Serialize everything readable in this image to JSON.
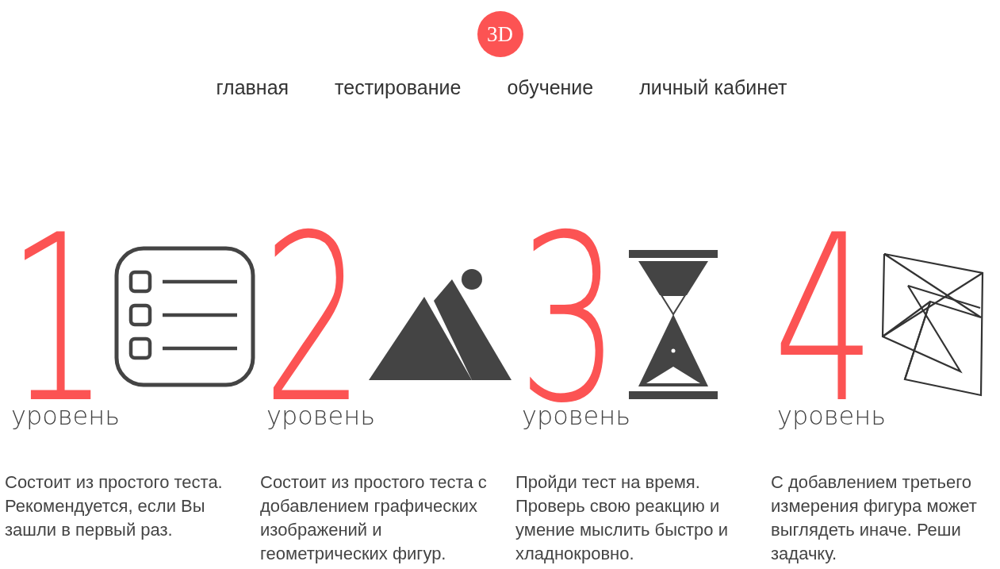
{
  "logo": {
    "text": "3D"
  },
  "nav": [
    "главная",
    "тестирование",
    "обучение",
    "личный кабинет"
  ],
  "levels": [
    {
      "number": "1",
      "label": "уровень",
      "kind": "list",
      "description": "Состоит из простого теста. Рекомендуется, если Вы зашли в первый раз."
    },
    {
      "number": "2",
      "label": "уровень",
      "kind": "mountains",
      "description": "Состоит из простого теста с добавлением графических изображений и геометрических фигур."
    },
    {
      "number": "3",
      "label": "уровень",
      "kind": "hourglass",
      "description": "Пройди тест на время. Проверь свою реакцию и умение мыслить быстро и хладнокровно."
    },
    {
      "number": "4",
      "label": "уровень",
      "kind": "wireframe",
      "description": "С добавлением третьего измерения фигура может выглядеть иначе. Реши задачку."
    }
  ]
}
